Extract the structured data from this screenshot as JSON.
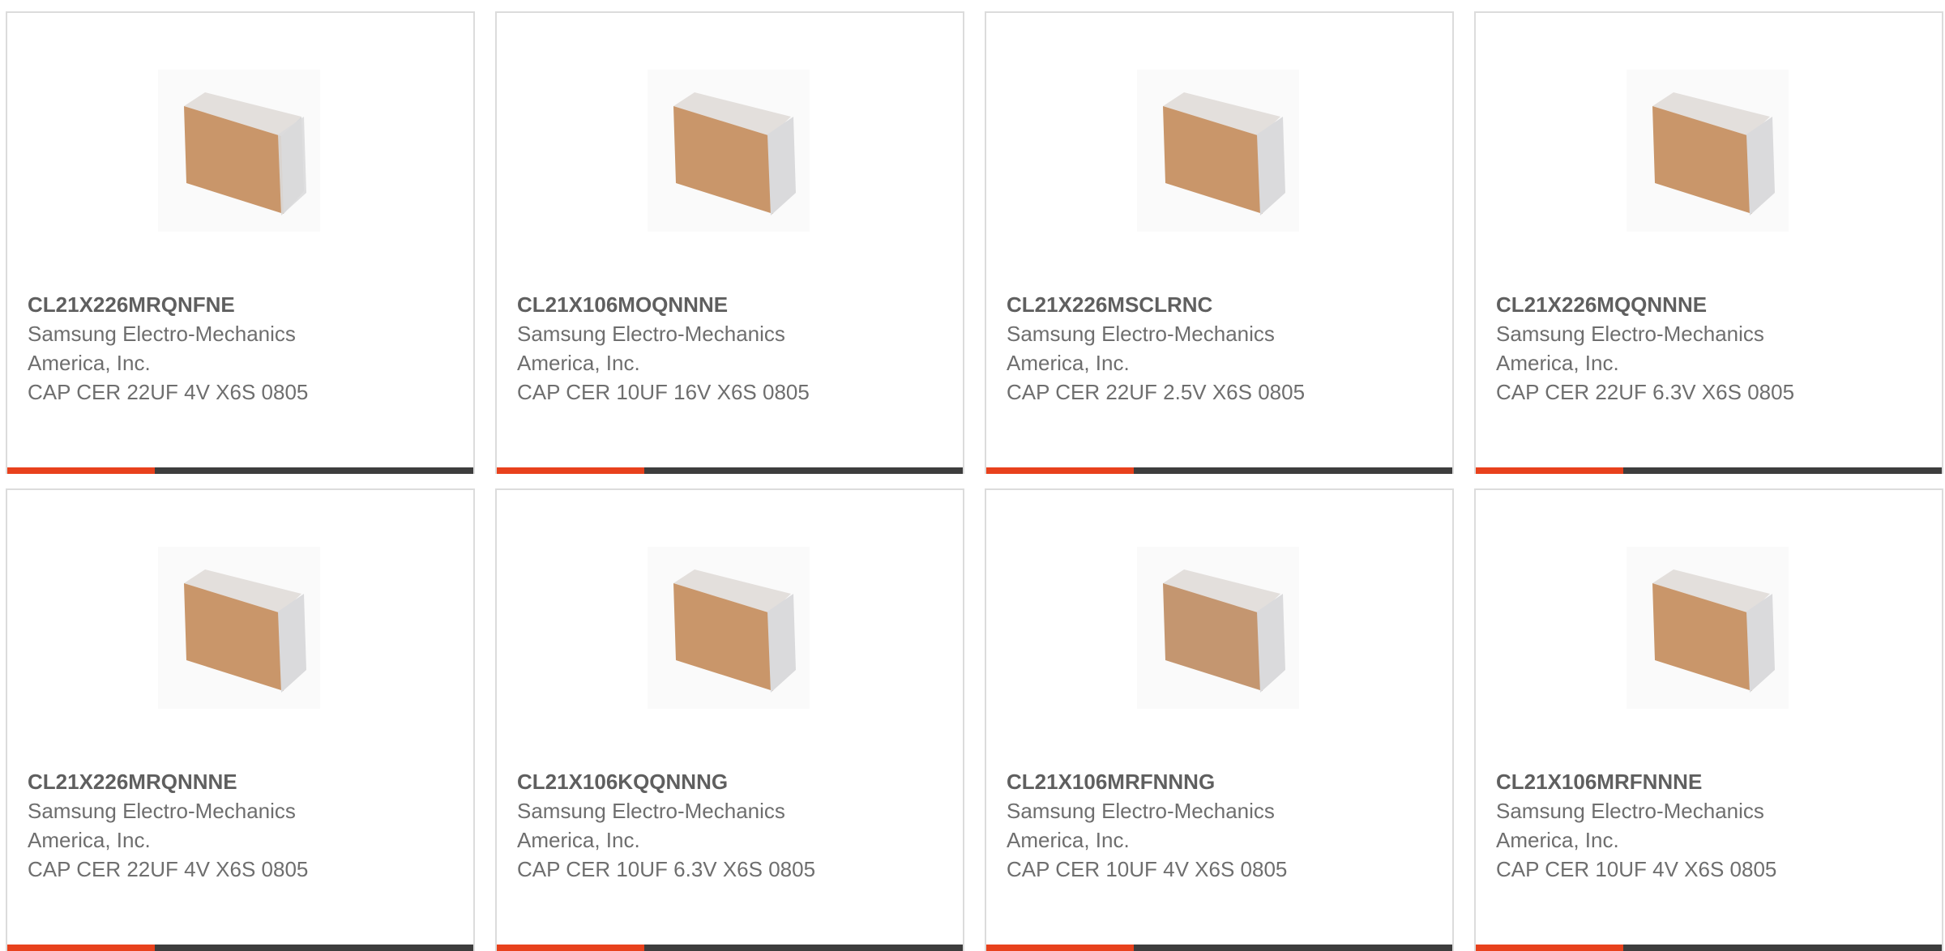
{
  "colors": {
    "accent": "#e8411c",
    "bar_dark": "#3d3d3d",
    "border": "#dcdcdc",
    "part_text": "#5f5f5f",
    "body_text": "#6e6e6e"
  },
  "products": [
    {
      "part_number": "CL21X226MRQNFNE",
      "manufacturer": "Samsung Electro-Mechanics America, Inc.",
      "description": "CAP CER 22UF 4V X6S 0805",
      "image_icon": "ceramic-capacitor-icon"
    },
    {
      "part_number": "CL21X106MOQNNNE",
      "manufacturer": "Samsung Electro-Mechanics America, Inc.",
      "description": "CAP CER 10UF 16V X6S 0805",
      "image_icon": "ceramic-capacitor-icon"
    },
    {
      "part_number": "CL21X226MSCLRNC",
      "manufacturer": "Samsung Electro-Mechanics America, Inc.",
      "description": "CAP CER 22UF 2.5V X6S 0805",
      "image_icon": "ceramic-capacitor-icon"
    },
    {
      "part_number": "CL21X226MQQNNNE",
      "manufacturer": "Samsung Electro-Mechanics America, Inc.",
      "description": "CAP CER 22UF 6.3V X6S 0805",
      "image_icon": "ceramic-capacitor-icon"
    },
    {
      "part_number": "CL21X226MRQNNNE",
      "manufacturer": "Samsung Electro-Mechanics America, Inc.",
      "description": "CAP CER 22UF 4V X6S 0805",
      "image_icon": "ceramic-capacitor-icon"
    },
    {
      "part_number": "CL21X106KQQNNNG",
      "manufacturer": "Samsung Electro-Mechanics America, Inc.",
      "description": "CAP CER 10UF 6.3V X6S 0805",
      "image_icon": "ceramic-capacitor-icon"
    },
    {
      "part_number": "CL21X106MRFNNNG",
      "manufacturer": "Samsung Electro-Mechanics America, Inc.",
      "description": "CAP CER 10UF 4V X6S 0805",
      "image_icon": "ceramic-capacitor-icon"
    },
    {
      "part_number": "CL21X106MRFNNNE",
      "manufacturer": "Samsung Electro-Mechanics America, Inc.",
      "description": "CAP CER 10UF 4V X6S 0805",
      "image_icon": "ceramic-capacitor-icon"
    }
  ]
}
